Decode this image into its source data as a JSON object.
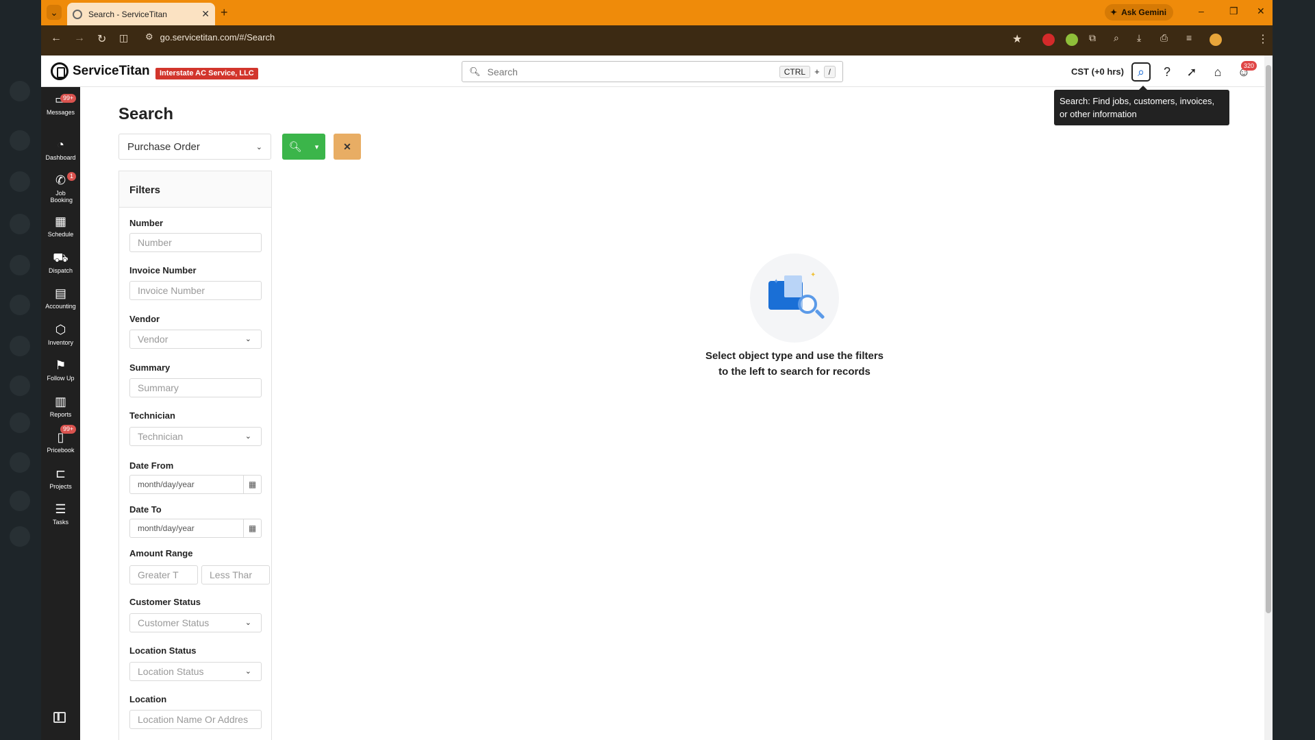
{
  "browser": {
    "tab_title": "Search - ServiceTitan",
    "new_tab": "+",
    "ask_gemini": "Ask Gemini",
    "url": "go.servicetitan.com/#/Search",
    "window_controls": [
      "–",
      "❐",
      "✕"
    ]
  },
  "app": {
    "logo_text": "ServiceTitan",
    "company_badge": "Interstate AC Service, LLC",
    "search_placeholder": "Search",
    "shortcut_key1": "CTRL",
    "shortcut_plus": "+",
    "shortcut_key2": "/",
    "timezone": "CST (+0 hrs)",
    "avatar_badge": "320",
    "tooltip": "Search: Find jobs, customers, invoices, or other information"
  },
  "sidebar": {
    "items": [
      {
        "label": "Messages",
        "icon": "message-icon",
        "badge": "99+"
      },
      {
        "label": "Dashboard",
        "icon": "gauge-icon"
      },
      {
        "label": "Job Booking",
        "icon": "phone-icon",
        "badge": "1"
      },
      {
        "label": "Schedule",
        "icon": "calendar-icon"
      },
      {
        "label": "Dispatch",
        "icon": "truck-icon"
      },
      {
        "label": "Accounting",
        "icon": "clipboard-icon"
      },
      {
        "label": "Inventory",
        "icon": "box-icon"
      },
      {
        "label": "Follow Up",
        "icon": "flag-icon"
      },
      {
        "label": "Reports",
        "icon": "bar-chart-icon"
      },
      {
        "label": "Pricebook",
        "icon": "book-icon",
        "badge": "99+"
      },
      {
        "label": "Projects",
        "icon": "folder-icon"
      },
      {
        "label": "Tasks",
        "icon": "list-icon"
      }
    ]
  },
  "page": {
    "title": "Search",
    "object_type": "Purchase Order",
    "filters_title": "Filters",
    "filters": {
      "number_label": "Number",
      "number_placeholder": "Number",
      "invoice_label": "Invoice Number",
      "invoice_placeholder": "Invoice Number",
      "vendor_label": "Vendor",
      "vendor_placeholder": "Vendor",
      "summary_label": "Summary",
      "summary_placeholder": "Summary",
      "technician_label": "Technician",
      "technician_placeholder": "Technician",
      "date_from_label": "Date From",
      "date_from_placeholder": "month/day/year",
      "date_to_label": "Date To",
      "date_to_placeholder": "month/day/year",
      "amount_label": "Amount Range",
      "amount_min_placeholder": "Greater T",
      "amount_max_placeholder": "Less Thar",
      "customer_status_label": "Customer Status",
      "customer_status_placeholder": "Customer Status",
      "location_status_label": "Location Status",
      "location_status_placeholder": "Location Status",
      "location_label": "Location",
      "location_placeholder": "Location Name Or Addres"
    },
    "empty_line1": "Select object type and use the filters",
    "empty_line2": "to the left to search for records"
  },
  "colors": {
    "browser_frame": "#ef8b0a",
    "search_button": "#3bb54a",
    "clear_button": "#e8ad64",
    "company_badge": "#d2352c",
    "sidebar": "#202020"
  }
}
